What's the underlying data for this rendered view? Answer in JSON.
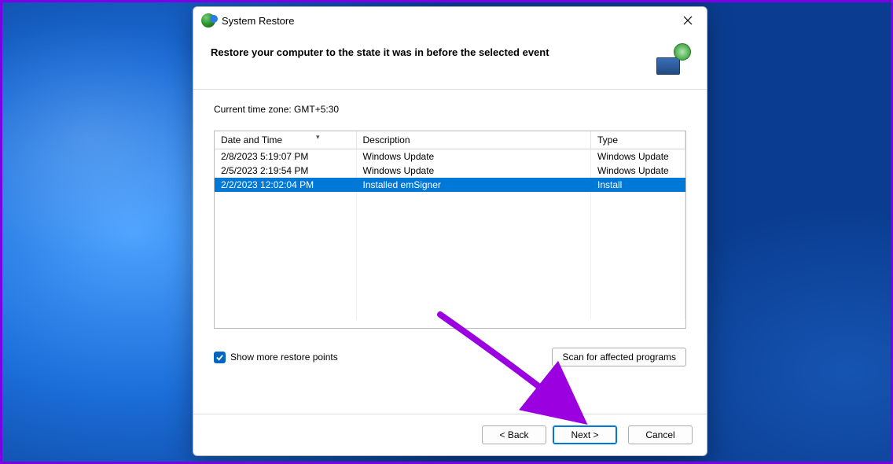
{
  "window": {
    "title": "System Restore"
  },
  "header": {
    "headline": "Restore your computer to the state it was in before the selected event"
  },
  "body": {
    "timezone_label": "Current time zone: GMT+5:30",
    "columns": {
      "date": "Date and Time",
      "desc": "Description",
      "type": "Type"
    },
    "rows": [
      {
        "date": "2/8/2023 5:19:07 PM",
        "desc": "Windows Update",
        "type": "Windows Update",
        "selected": false
      },
      {
        "date": "2/5/2023 2:19:54 PM",
        "desc": "Windows Update",
        "type": "Windows Update",
        "selected": false
      },
      {
        "date": "2/2/2023 12:02:04 PM",
        "desc": "Installed emSigner",
        "type": "Install",
        "selected": true
      }
    ],
    "show_more_label": "Show more restore points",
    "scan_button": "Scan for affected programs"
  },
  "footer": {
    "back": "< Back",
    "next": "Next >",
    "cancel": "Cancel"
  }
}
